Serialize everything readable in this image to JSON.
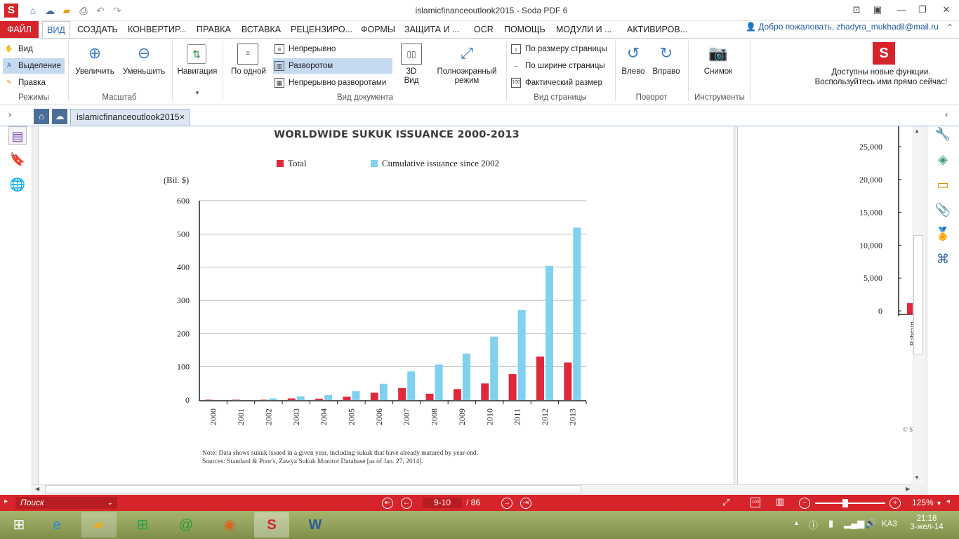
{
  "window": {
    "title": "islamicfinanceoutlook2015    -    Soda PDF 6",
    "controls": [
      "min",
      "restore",
      "close"
    ]
  },
  "menu": {
    "tabs": [
      "ФАЙЛ",
      "ВИД",
      "СОЗДАТЬ",
      "КОНВЕРТИР...",
      "ПРАВКА",
      "ВСТАВКА",
      "РЕЦЕНЗИРО...",
      "ФОРМЫ",
      "ЗАЩИТА И ...",
      "OCR",
      "ПОМОЩЬ",
      "МОДУЛИ И ...",
      "АКТИВИРОВ..."
    ],
    "active": "ВИД",
    "welcome": "Добро пожаловать, zhadyra_mukhadil@mail.ru"
  },
  "ribbon": {
    "modes": {
      "items": [
        "Вид",
        "Выделение",
        "Правка"
      ],
      "group": "Режимы"
    },
    "zoom": {
      "zoom_in": "Увеличить",
      "zoom_out": "Уменьшить",
      "group": "Масштаб"
    },
    "navigation": {
      "label": "Навигация"
    },
    "doc_view": {
      "single": "По одной",
      "continuous": "Непрерывно",
      "facing": "Разворотом",
      "continuous_facing": "Непрерывно разворотами",
      "view3d_line1": "3D",
      "view3d_line2": "Вид",
      "fullscreen_line1": "Полноэкранный",
      "fullscreen_line2": "режим",
      "group": "Вид документа"
    },
    "page_view": {
      "fit_page": "По размеру страницы",
      "fit_width": "По ширине страницы",
      "actual_size": "Фактический размер",
      "group": "Вид страницы"
    },
    "rotate": {
      "left": "Влево",
      "right": "Вправо",
      "group": "Поворот"
    },
    "tools": {
      "snapshot": "Снимок",
      "group": "Инструменты"
    },
    "promo_line1": "Доступны новые функции.",
    "promo_line2": "Воспользуйтесь ими прямо сейчас!"
  },
  "document_tab": {
    "name": "islamicfinanceoutlook2015",
    "close": "×"
  },
  "chart_data": {
    "type": "bar",
    "title": "WORLDWIDE SUKUK ISSUANCE 2000-2013",
    "ylabel": "(Bil. $)",
    "categories": [
      "2000",
      "2001",
      "2002",
      "2003",
      "2004",
      "2005",
      "2006",
      "2007",
      "2008",
      "2009",
      "2010",
      "2011",
      "2012",
      "2013"
    ],
    "series": [
      {
        "name": "Total",
        "color": "#e0283d",
        "values": [
          1,
          1,
          1,
          5,
          4,
          10,
          22,
          36,
          19,
          33,
          50,
          78,
          131,
          113
        ]
      },
      {
        "name": "Cumulative issuance since 2002",
        "color": "#7fd1ee",
        "values": [
          0,
          0,
          5,
          11,
          15,
          27,
          49,
          86,
          107,
          140,
          191,
          271,
          404,
          519
        ]
      }
    ],
    "ylim": [
      0,
      600
    ],
    "yticks": [
      "0",
      "100",
      "200",
      "300",
      "400",
      "500",
      "600"
    ],
    "grid": true,
    "legend": "top"
  },
  "notes": {
    "line1": "Note: Data shows sukuk issued in a given year, including sukuk that have already matured by year-end.",
    "line2": "Sources: Standard & Poor's, Zawya Sukuk Monitor Database [as of Jan. 27, 2014]."
  },
  "right_chart": {
    "yticks": [
      "25,000",
      "20,000",
      "15,000",
      "10,000",
      "5,000",
      "0"
    ],
    "partial_label": "Bahrain",
    "copyright_fragment": "© S"
  },
  "status": {
    "search_placeholder": "Поиск",
    "page_current": "9-10",
    "page_total": "/ 86",
    "zoom": "125%"
  },
  "taskbar": {
    "lang": "KA3",
    "time": "21:18",
    "date": "3-жел-14"
  }
}
